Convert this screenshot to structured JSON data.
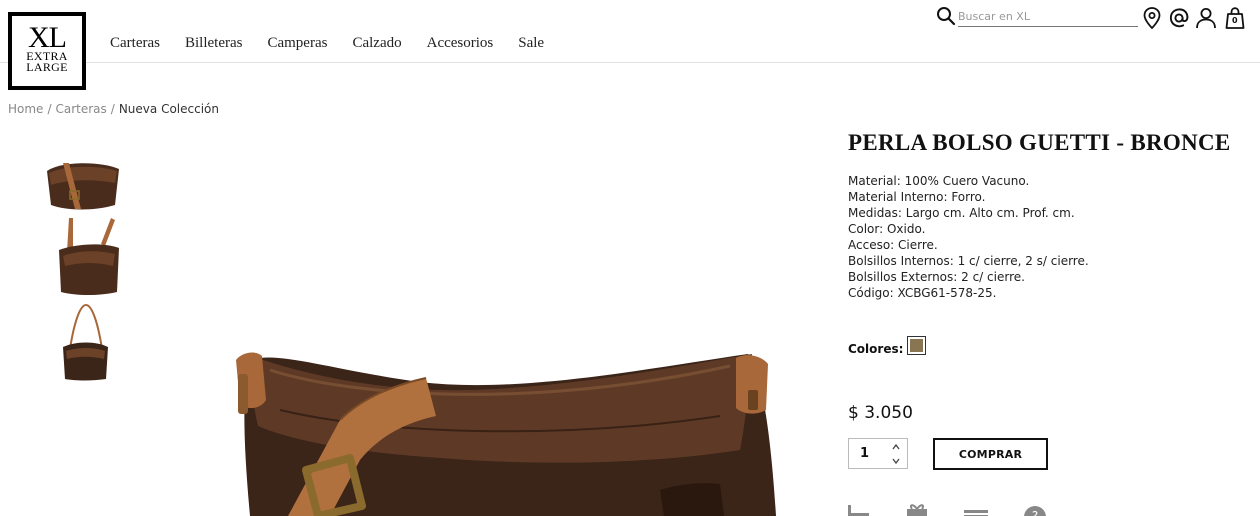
{
  "header": {
    "logo": {
      "line1": "XL",
      "line2": "EXTRA",
      "line3": "LARGE"
    },
    "nav": [
      "Carteras",
      "Billeteras",
      "Camperas",
      "Calzado",
      "Accesorios",
      "Sale"
    ],
    "search": {
      "placeholder": "Buscar en XL",
      "value": ""
    },
    "icons": [
      "search-icon",
      "location-icon",
      "contact-at-icon",
      "user-icon",
      "cart-icon"
    ],
    "cart_count": "0"
  },
  "breadcrumb": {
    "items": [
      "Home",
      "Carteras",
      "Nueva Colección"
    ],
    "separator": "/"
  },
  "product": {
    "title": "PERLA BOLSO GUETTI - BRONCE",
    "details": [
      "Material: 100% Cuero Vacuno.",
      "Material Interno: Forro.",
      "Medidas: Largo cm. Alto cm. Prof. cm.",
      "Color: Oxido.",
      "Acceso: Cierre.",
      "Bolsillos Internos: 1 c/ cierre, 2 s/ cierre.",
      "Bolsillos Externos: 2 c/ cierre.",
      "Código: XCBG61-578-25."
    ],
    "colors_label": "Colores:",
    "color_swatch": "#8a7552",
    "price": "$ 3.050",
    "quantity": "1",
    "buy_label": "COMPRAR"
  },
  "colors": {
    "leather_dark": "#3b2418",
    "leather_mid": "#5e3a26",
    "strap": "#a8683a",
    "buckle": "#8b6a2e"
  }
}
